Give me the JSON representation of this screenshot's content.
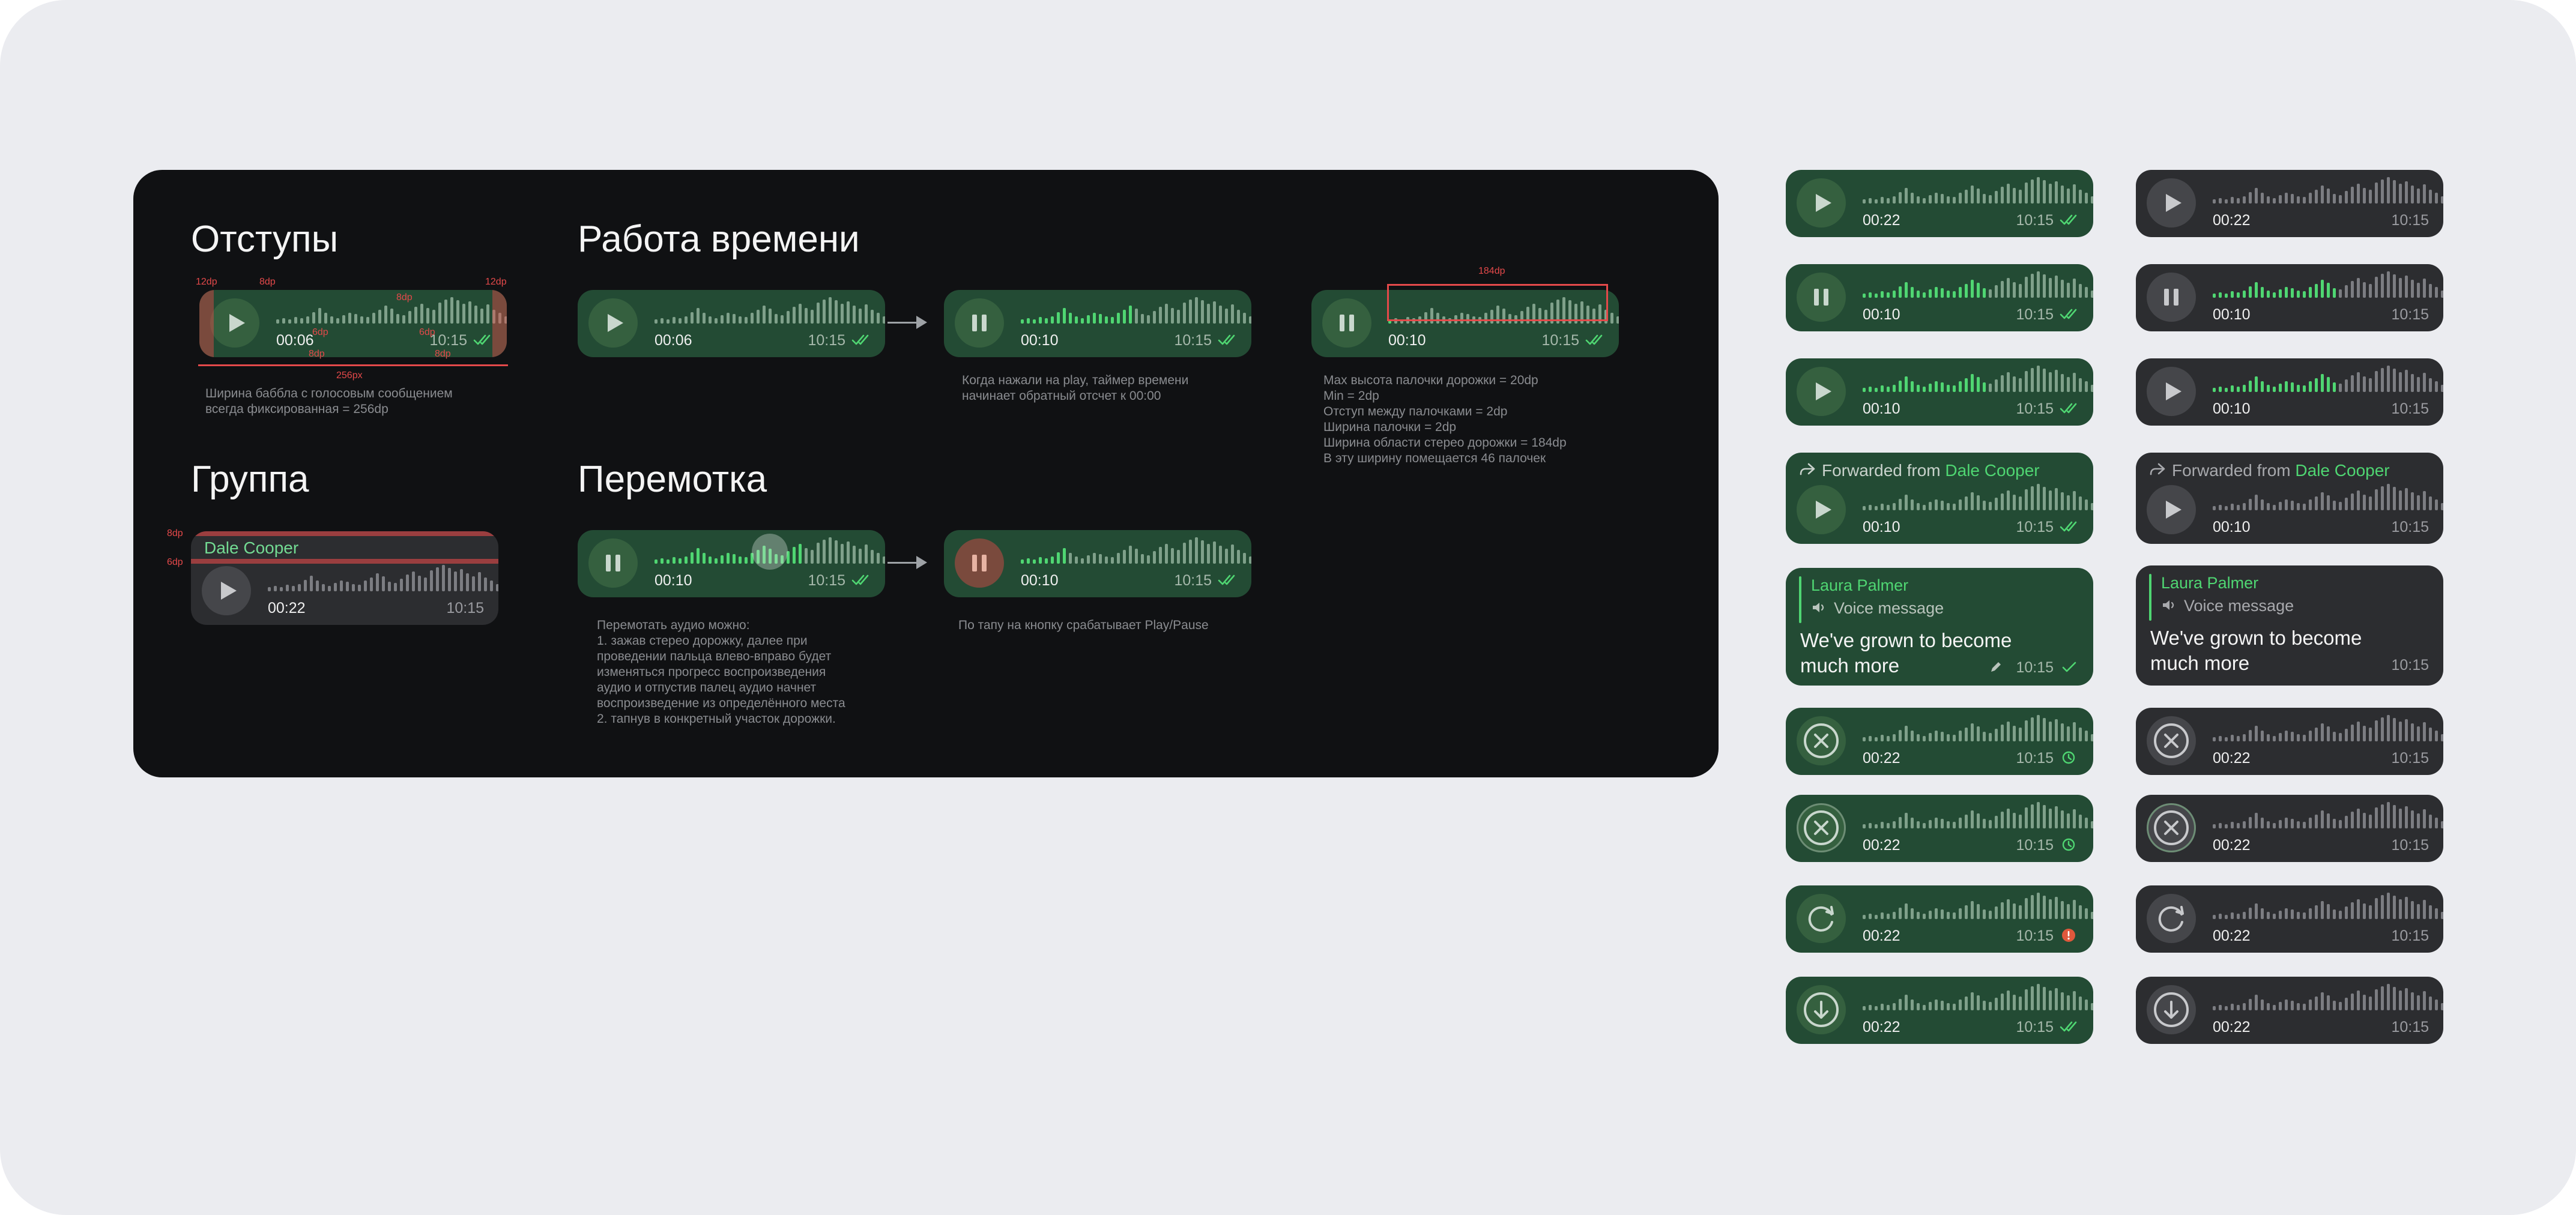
{
  "sections": {
    "paddings_title": "Отступы",
    "time_title": "Работа времени",
    "group_title": "Группа",
    "rewind_title": "Перемотка"
  },
  "captions": {
    "paddings": "Ширина баббла с голосовым сообщением\nвсегда фиксированная = 256dp",
    "time_1": "Когда нажали на play, таймер времени\nначинает обратный отсчет к 00:00",
    "time_2": "Max высота палочки дорожки = 20dp\nMin = 2dp\nОтступ между палочками = 2dp\nШирина палочки = 2dp\nШирина области стерео дорожки = 184dp\nВ эту ширину помещается 46 палочек",
    "rewind_1": "Перемотать аудио можно:\n1. зажав стерео дорожку, далее при\nпроведении пальца влево-вправо будет\nизменяться прогресс воспроизведения\nаудио и отпустив палец аудио начнет\nвоспроизведение из определённого места\n2. тапнув в конкретный участок дорожки.",
    "rewind_2": "По тапу на кнопку срабатывает Play/Pause"
  },
  "annotations": {
    "dp12": "12dp",
    "dp8": "8dp",
    "dp6": "6dp",
    "dp256": "256px",
    "dp184": "184dp"
  },
  "group": {
    "sender": "Dale Cooper"
  },
  "forwarded": {
    "label": "Forwarded from ",
    "name": "Dale Cooper"
  },
  "reply": {
    "name": "Laura Palmer",
    "kind": "Voice message",
    "text": "We've grown to become much more"
  },
  "times": {
    "d0006": "00:06",
    "d0010": "00:10",
    "d0022": "00:22",
    "clock": "10:15"
  },
  "colors": {
    "panel": "#101113",
    "bubble_green": "#234b34",
    "bubble_dark": "#2c2d30",
    "accent_green": "#4fd672",
    "annotation_red": "#e4494a",
    "error_orange": "#e0583c"
  },
  "icons": {
    "play": "play-icon",
    "pause": "pause-icon",
    "cancel": "close-icon",
    "retry": "refresh-icon",
    "download": "download-icon",
    "read": "double-check-icon",
    "sent": "check-icon",
    "pending": "clock-icon",
    "error": "exclamation-icon",
    "forward": "forward-icon",
    "speaker": "speaker-icon",
    "edited": "pencil-icon"
  }
}
